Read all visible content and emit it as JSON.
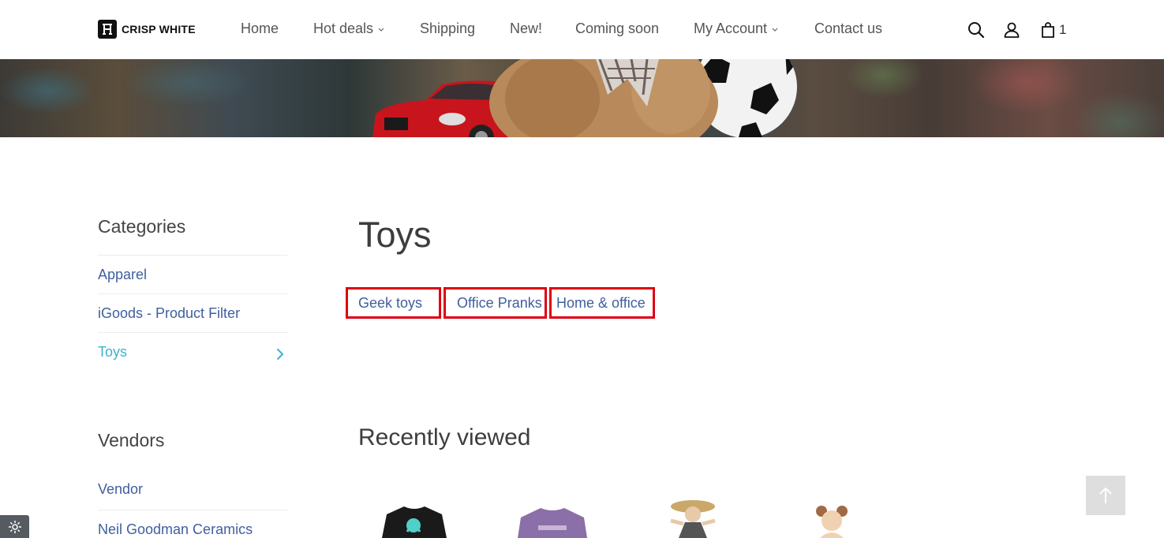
{
  "header": {
    "logo_text": "CRISP WHITE",
    "nav": [
      {
        "label": "Home"
      },
      {
        "label": "Hot deals"
      },
      {
        "label": "Shipping"
      },
      {
        "label": "New!"
      },
      {
        "label": "Coming soon"
      },
      {
        "label": "My Account"
      },
      {
        "label": "Contact us"
      }
    ],
    "cart_count": "1"
  },
  "sidebar": {
    "categories_title": "Categories",
    "categories": [
      {
        "label": "Apparel"
      },
      {
        "label": "iGoods - Product Filter"
      },
      {
        "label": "Toys"
      }
    ],
    "vendors_title": "Vendors",
    "vendors": [
      {
        "label": "Vendor"
      },
      {
        "label": "Neil Goodman Ceramics"
      }
    ]
  },
  "main": {
    "title": "Toys",
    "subcategories": [
      {
        "label": "Geek toys"
      },
      {
        "label": "Office Pranks"
      },
      {
        "label": "Home & office"
      }
    ],
    "recently_viewed_title": "Recently viewed"
  },
  "colors": {
    "link": "#3f5f9e",
    "active_link": "#3bb3cf",
    "highlight_box": "#e00010"
  }
}
